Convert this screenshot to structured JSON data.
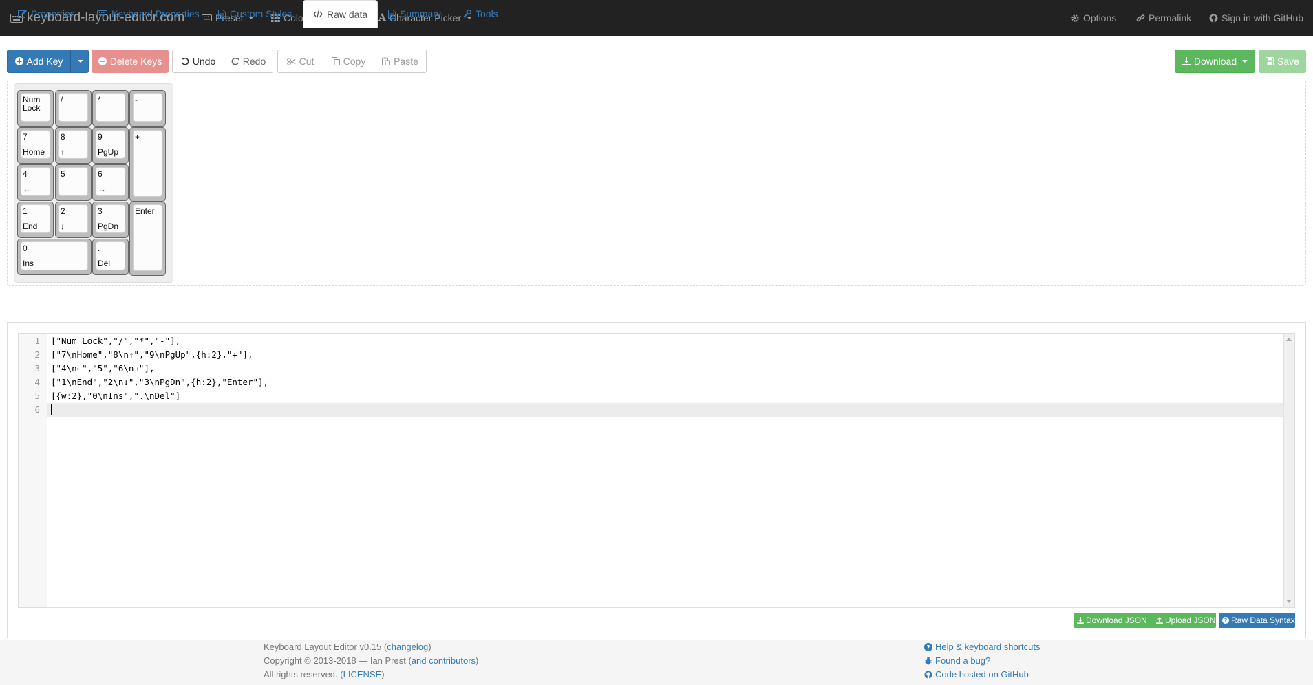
{
  "navbar": {
    "brand": "keyboard-layout-editor.com",
    "left_items": [
      {
        "label": "Preset",
        "icon": "keyboard-icon"
      },
      {
        "label": "Color Swatches",
        "icon": "grid-icon"
      },
      {
        "label": "Character Picker",
        "icon": "font-icon"
      }
    ],
    "right_items": [
      {
        "label": "Options",
        "icon": "gear-icon"
      },
      {
        "label": "Permalink",
        "icon": "link-icon"
      },
      {
        "label": "Sign in with GitHub",
        "icon": "github-icon"
      }
    ]
  },
  "toolbar": {
    "add_key": "Add Key",
    "delete_keys": "Delete Keys",
    "undo": "Undo",
    "redo": "Redo",
    "cut": "Cut",
    "copy": "Copy",
    "paste": "Paste",
    "download": "Download",
    "save": "Save"
  },
  "keys": [
    {
      "top": "Num Lock",
      "bottom": ""
    },
    {
      "top": "/",
      "bottom": ""
    },
    {
      "top": "*",
      "bottom": ""
    },
    {
      "top": "-",
      "bottom": ""
    },
    {
      "top": "7",
      "bottom": "Home"
    },
    {
      "top": "8",
      "bottom": "↑"
    },
    {
      "top": "9",
      "bottom": "PgUp"
    },
    {
      "top": "+",
      "bottom": ""
    },
    {
      "top": "4",
      "bottom": "←"
    },
    {
      "top": "5",
      "bottom": ""
    },
    {
      "top": "6",
      "bottom": "→"
    },
    {
      "top": "1",
      "bottom": "End"
    },
    {
      "top": "2",
      "bottom": "↓"
    },
    {
      "top": "3",
      "bottom": "PgDn"
    },
    {
      "top": "Enter",
      "bottom": ""
    },
    {
      "top": "0",
      "bottom": "Ins"
    },
    {
      "top": ".",
      "bottom": "Del"
    }
  ],
  "tabs": [
    {
      "label": "Properties",
      "icon": "edit-icon"
    },
    {
      "label": "Keyboard Properties",
      "icon": "keyboard-icon"
    },
    {
      "label": "Custom Styles",
      "icon": "file-icon"
    },
    {
      "label": "Raw data",
      "icon": "code-icon"
    },
    {
      "label": "Summary",
      "icon": "list-icon"
    },
    {
      "label": "Tools",
      "icon": "wrench-icon"
    }
  ],
  "active_tab": "Raw data",
  "editor": {
    "line_numbers": [
      "1",
      "2",
      "3",
      "4",
      "5",
      "6"
    ],
    "lines": [
      "[\"Num Lock\",\"/\",\"*\",\"-\"],",
      "[\"7\\nHome\",\"8\\n↑\",\"9\\nPgUp\",{h:2},\"+\"],",
      "[\"4\\n←\",\"5\",\"6\\n→\"],",
      "[\"1\\nEnd\",\"2\\n↓\",\"3\\nPgDn\",{h:2},\"Enter\"],",
      "[{w:2},\"0\\nIns\",\".\\nDel\"]",
      ""
    ]
  },
  "raw_buttons": {
    "download_json": "Download JSON",
    "upload_json": "Upload JSON",
    "raw_data_syntax": "Raw Data Syntax"
  },
  "footer": {
    "version": "Keyboard Layout Editor v0.15",
    "changelog": "changelog",
    "copyright": "Copyright © 2013-2018 — Ian Prest",
    "contributors": "and contributors",
    "rights": "All rights reserved.",
    "license": "LICENSE",
    "help": "Help & keyboard shortcuts",
    "bug": "Found a bug?",
    "github": "Code hosted on GitHub"
  },
  "colors": {
    "navbar_bg": "#222222",
    "primary": "#337ab7",
    "success": "#5cb85c",
    "danger_disabled": "#e7908e"
  }
}
